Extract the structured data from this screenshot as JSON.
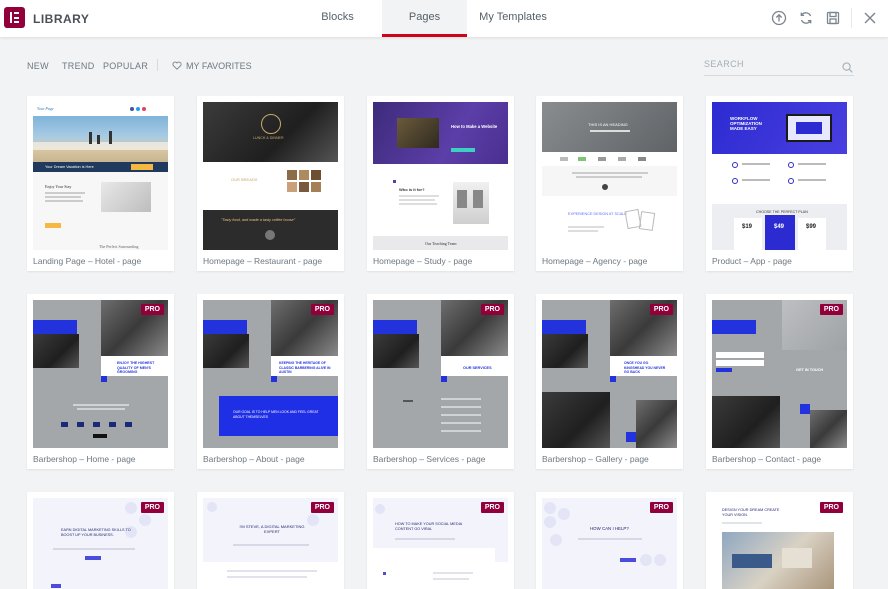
{
  "header": {
    "brand": "LIBRARY",
    "tabs": [
      {
        "label": "Blocks"
      },
      {
        "label": "Pages"
      },
      {
        "label": "My Templates"
      }
    ],
    "icons": [
      "upload-icon",
      "sync-icon",
      "save-icon",
      "close-icon"
    ]
  },
  "filters": {
    "new": "NEW",
    "trend": "TREND",
    "popular": "POPULAR",
    "favorites": "MY FAVORITES",
    "search_placeholder": "SEARCH"
  },
  "badge": "PRO",
  "colors": {
    "brand": "#92003b",
    "active_tab_border": "#d0021b",
    "barber_blue": "#2233dd",
    "gray_bg": "#f1f3f5"
  },
  "templates": [
    {
      "title": "Landing Page – Hotel - page"
    },
    {
      "title": "Homepage – Restaurant - page"
    },
    {
      "title": "Homepage – Study - page"
    },
    {
      "title": "Homepage – Agency - page"
    },
    {
      "title": "Product – App - page"
    },
    {
      "title": "Barbershop – Home - page"
    },
    {
      "title": "Barbershop – About - page"
    },
    {
      "title": "Barbershop – Services - page"
    },
    {
      "title": "Barbershop – Gallery - page"
    },
    {
      "title": "Barbershop – Contact - page"
    }
  ],
  "previews": {
    "hotel": {
      "logo": "Your Page",
      "banner": "Your Dream Vacation is Here",
      "heading": "Enjoy Your Stay",
      "caption": "The Perfect Surrounding"
    },
    "restaurant": {
      "sign": "LUNCH & DINNER",
      "heading": "OUR BREADS",
      "quote": "\"Tasty food, and made a tasty coffee house\""
    },
    "study": {
      "heading": "How to Make a Website",
      "section": "Who is it for?",
      "footer": "Our Teaching Team"
    },
    "agency": {
      "heading": "THIS IS AN HEADING",
      "label": "EXPERIENCE DESIGN AT SCALE"
    },
    "app": {
      "heading": "WORKFLOW OPTIMIZATION MADE EASY",
      "plan": "CHOOSE THE PERFECT PLAN",
      "prices": [
        "$19",
        "$49",
        "$99"
      ]
    },
    "barber_home": {
      "headline": "ENJOY THE HIGHEST QUALITY OF MEN'S GROOMING"
    },
    "barber_about": {
      "headline": "KEEPING THE HERITAGE OF CLASSIC BARBERING ALIVE IN AUSTIN",
      "quote": "OUR GOAL IS TO HELP MEN LOOK AND FEEL GREAT ABOUT THEMSELVES"
    },
    "barber_services": {
      "headline": "OUR SERVICES"
    },
    "barber_gallery": {
      "headline": "ONCE YOU GO KINGSHEAD YOU NEVER GO BACK"
    },
    "barber_contact": {
      "headline": "GET IN TOUCH"
    },
    "row3": [
      {
        "text": "EARN DIGITAL MARKETING SKILLS TO BOOST UP YOUR BUSINESS."
      },
      {
        "text": "I'M STEVE, A DIGITAL MARKETING EXPERT"
      },
      {
        "text": "HOW TO MAKE YOUR SOCIAL MEDIA CONTENT GO VIRAL"
      },
      {
        "text": "HOW CAN I HELP?"
      },
      {
        "text": "DESIGN YOUR DREAM CREATE YOUR VISION."
      }
    ]
  }
}
